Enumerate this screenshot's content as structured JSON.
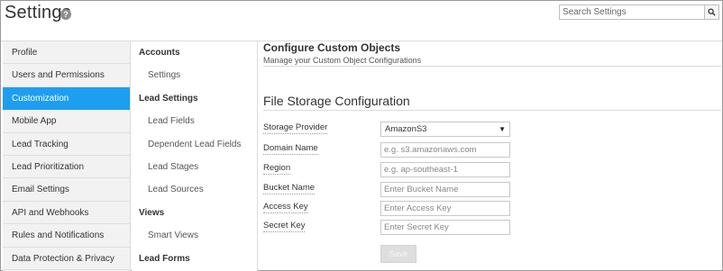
{
  "header": {
    "title": "Settings",
    "help_glyph": "?",
    "search": {
      "placeholder": "Search Settings",
      "value": ""
    }
  },
  "left_nav": {
    "items": [
      {
        "label": "Profile"
      },
      {
        "label": "Users and Permissions"
      },
      {
        "label": "Customization",
        "active": true
      },
      {
        "label": "Mobile App"
      },
      {
        "label": "Lead Tracking"
      },
      {
        "label": "Lead Prioritization"
      },
      {
        "label": "Email Settings"
      },
      {
        "label": "API and Webhooks"
      },
      {
        "label": "Rules and Notifications"
      },
      {
        "label": "Data Protection & Privacy"
      }
    ]
  },
  "mid_nav": {
    "accounts": {
      "title": "Accounts",
      "items": [
        "Settings"
      ]
    },
    "lead_settings": {
      "title": "Lead Settings",
      "items": [
        "Lead Fields",
        "Dependent Lead Fields",
        "Lead Stages",
        "Lead Sources"
      ]
    },
    "views": {
      "title": "Views",
      "items": [
        "Smart Views"
      ]
    },
    "lead_forms": {
      "title": "Lead Forms"
    }
  },
  "main": {
    "title": "Configure Custom Objects",
    "subtitle": "Manage your Custom Object Configurations",
    "section_title": "File Storage Configuration",
    "form": {
      "storage_provider": {
        "label": "Storage Provider",
        "value": "AmazonS3"
      },
      "domain_name": {
        "label": "Domain Name",
        "placeholder": "e.g. s3.amazonaws.com"
      },
      "region": {
        "label": "Region",
        "placeholder": "e.g. ap-southeast-1"
      },
      "bucket_name": {
        "label": "Bucket Name",
        "placeholder": "Enter Bucket Name"
      },
      "access_key": {
        "label": "Access Key",
        "placeholder": "Enter Access Key"
      },
      "secret_key": {
        "label": "Secret Key",
        "placeholder": "Enter Secret Key"
      }
    },
    "save_label": "Save"
  },
  "colors": {
    "accent": "#1e9ef0",
    "nav_bg": "#f2f2f2"
  }
}
